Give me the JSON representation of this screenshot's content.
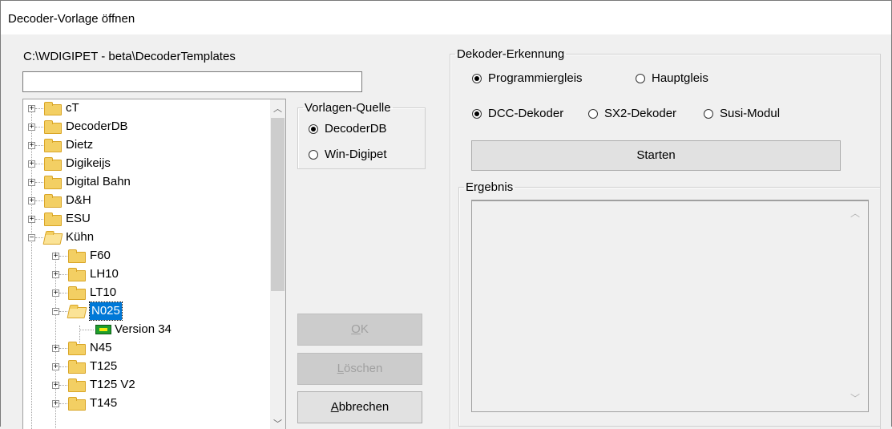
{
  "window": {
    "title": "Decoder-Vorlage öffnen"
  },
  "path_label": "C:\\WDIGIPET - beta\\DecoderTemplates",
  "name_input": {
    "value": ""
  },
  "tree": {
    "items": [
      {
        "label": "cT"
      },
      {
        "label": "DecoderDB"
      },
      {
        "label": "Dietz"
      },
      {
        "label": "Digikeijs"
      },
      {
        "label": "Digital Bahn"
      },
      {
        "label": "D&H"
      },
      {
        "label": "ESU"
      },
      {
        "label": "Kühn"
      },
      {
        "label": "F60"
      },
      {
        "label": "LH10"
      },
      {
        "label": "LT10"
      },
      {
        "label": "N025"
      },
      {
        "label": "Version 34"
      },
      {
        "label": "N45"
      },
      {
        "label": "T125"
      },
      {
        "label": "T125 V2"
      },
      {
        "label": "T145"
      }
    ],
    "selected": "N025"
  },
  "source_group": {
    "legend": "Vorlagen-Quelle",
    "options": [
      "DecoderDB",
      "Win-Digipet"
    ],
    "selected": "DecoderDB"
  },
  "buttons": {
    "ok": "OK",
    "delete": "Löschen",
    "cancel": "Abbrechen",
    "start": "Starten"
  },
  "detection": {
    "legend": "Dekoder-Erkennung",
    "track_options": [
      "Programmiergleis",
      "Hauptgleis"
    ],
    "track_selected": "Programmiergleis",
    "type_options": [
      "DCC-Dekoder",
      "SX2-Dekoder",
      "Susi-Modul"
    ],
    "type_selected": "DCC-Dekoder"
  },
  "result": {
    "legend": "Ergebnis",
    "text": ""
  }
}
